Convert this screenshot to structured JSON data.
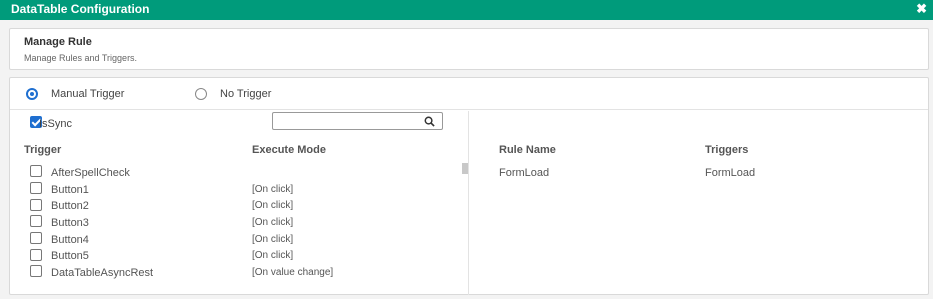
{
  "dialog": {
    "title": "DataTable Configuration",
    "close_glyph": "✖",
    "accent_color": "#009b7b"
  },
  "manage_rule": {
    "heading": "Manage Rule",
    "subtitle": "Manage Rules and Triggers."
  },
  "trigger_type": {
    "manual_label": "Manual Trigger",
    "none_label": "No Trigger",
    "selected": "Manual Trigger"
  },
  "issync": {
    "label": "IsSync",
    "checked": true
  },
  "search": {
    "value": "",
    "icon": "search-icon"
  },
  "left_table": {
    "headers": [
      "Trigger",
      "Execute Mode"
    ],
    "rows": [
      {
        "trigger": "AfterSpellCheck",
        "mode": ""
      },
      {
        "trigger": "Button1",
        "mode": "[On click]"
      },
      {
        "trigger": "Button2",
        "mode": "[On click]"
      },
      {
        "trigger": "Button3",
        "mode": "[On click]"
      },
      {
        "trigger": "Button4",
        "mode": "[On click]"
      },
      {
        "trigger": "Button5",
        "mode": "[On click]"
      },
      {
        "trigger": "DataTableAsyncRest",
        "mode": "[On value change]"
      }
    ]
  },
  "right_table": {
    "headers": [
      "Rule Name",
      "Triggers"
    ],
    "rows": [
      {
        "rule_name": "FormLoad",
        "triggers": "FormLoad"
      }
    ]
  }
}
